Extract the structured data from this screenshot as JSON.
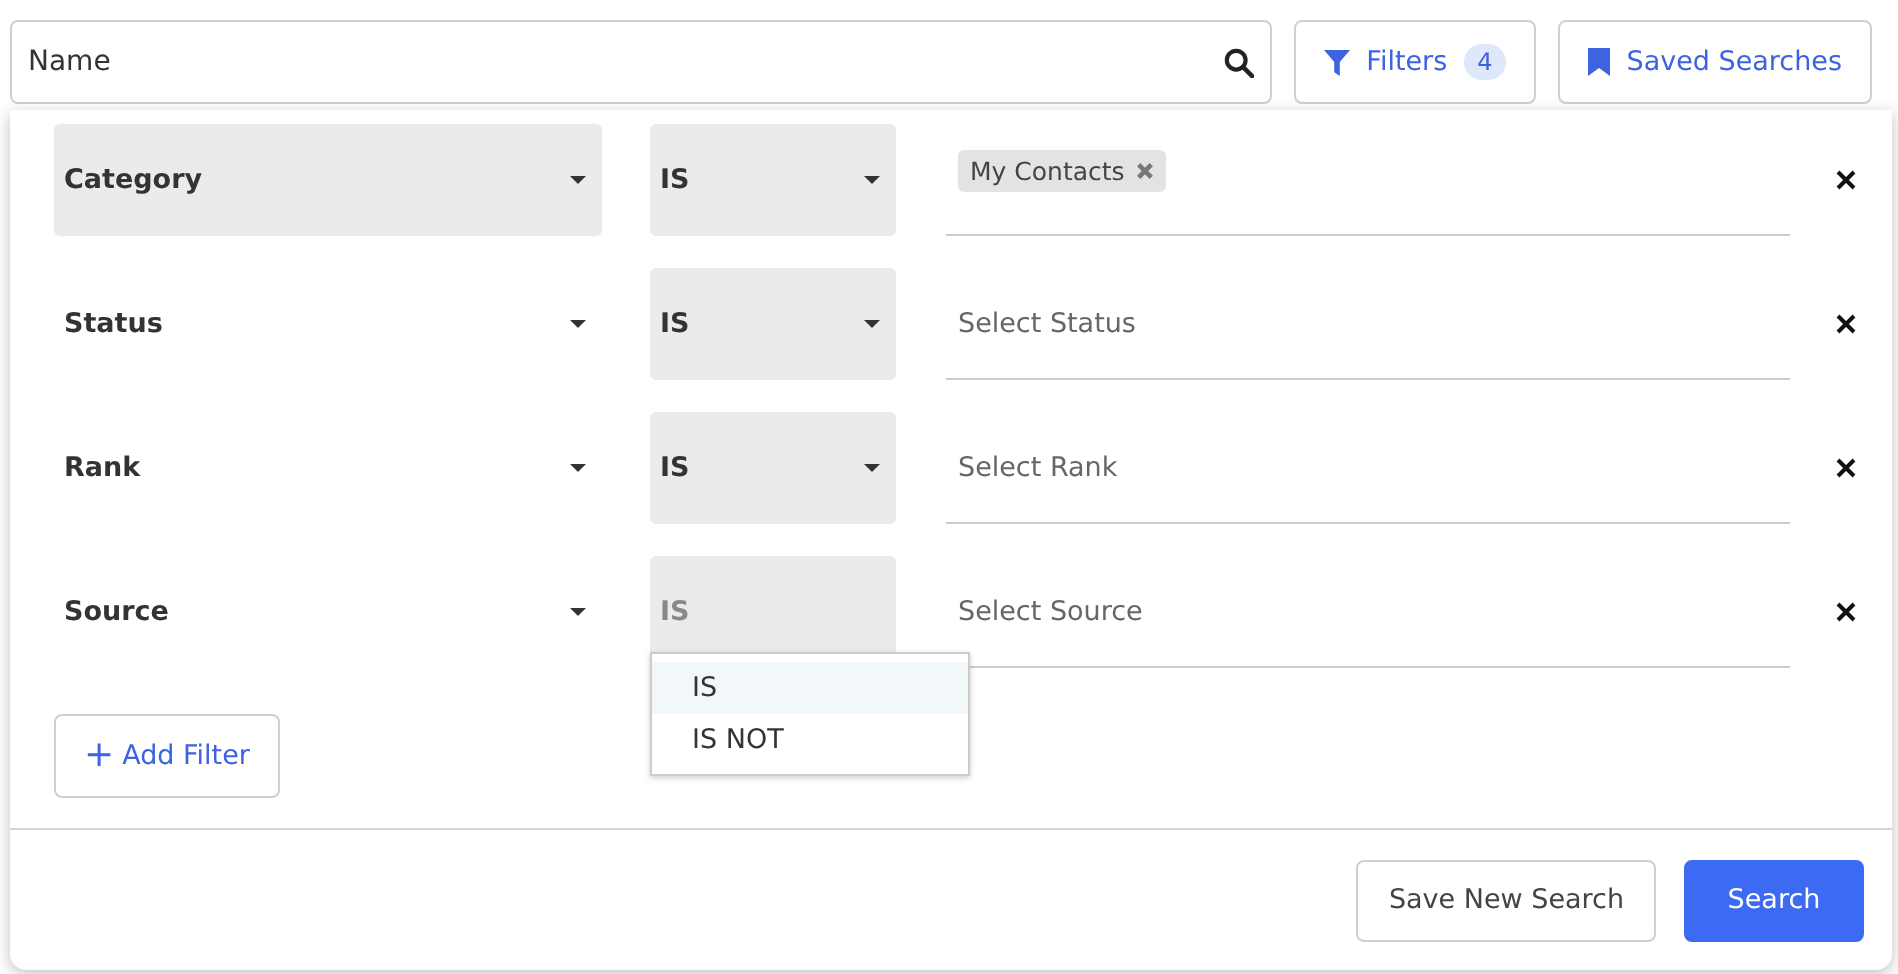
{
  "search": {
    "value": "Name"
  },
  "filters_button": {
    "label": "Filters",
    "count": "4"
  },
  "saved_searches_button": {
    "label": "Saved Searches"
  },
  "filters": [
    {
      "field": "Category",
      "field_focused": true,
      "operator": "IS",
      "operator_open": false,
      "chips": [
        "My Contacts"
      ]
    },
    {
      "field": "Status",
      "field_focused": false,
      "operator": "IS",
      "operator_open": false,
      "placeholder": "Select Status"
    },
    {
      "field": "Rank",
      "field_focused": false,
      "operator": "IS",
      "operator_open": false,
      "placeholder": "Select Rank"
    },
    {
      "field": "Source",
      "field_focused": false,
      "operator": "IS",
      "operator_open": true,
      "placeholder": "Select Source"
    }
  ],
  "operator_menu": [
    {
      "label": "IS",
      "selected": true
    },
    {
      "label": "IS NOT",
      "selected": false
    }
  ],
  "add_filter_button": {
    "icon": "+",
    "label": "Add Filter"
  },
  "footer_buttons": [
    {
      "label": "Save New Search",
      "kind": "secondary"
    },
    {
      "label": "Search",
      "kind": "primary"
    }
  ]
}
